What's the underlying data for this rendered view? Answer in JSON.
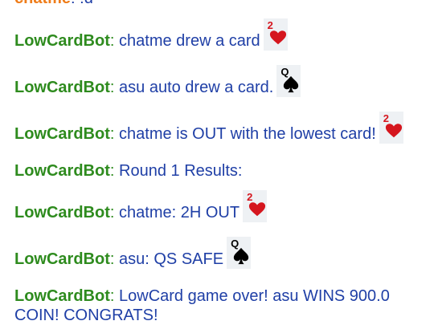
{
  "top": {
    "sender": "chatme",
    "text": ": !d"
  },
  "messages": [
    {
      "sender": "LowCardBot",
      "text": "chatme drew a card",
      "card": {
        "rank": "2",
        "suit": "hearts",
        "color": "#d5161e"
      }
    },
    {
      "sender": "LowCardBot",
      "text": "asu auto drew a card.",
      "card": {
        "rank": "Q",
        "suit": "spades",
        "color": "#000000"
      }
    },
    {
      "sender": "LowCardBot",
      "text": "chatme is OUT with the lowest card!",
      "card": {
        "rank": "2",
        "suit": "hearts",
        "color": "#d5161e"
      }
    },
    {
      "sender": "LowCardBot",
      "text": "Round 1 Results:"
    },
    {
      "sender": "LowCardBot",
      "text": "chatme: 2H OUT",
      "card": {
        "rank": "2",
        "suit": "hearts",
        "color": "#d5161e"
      }
    },
    {
      "sender": "LowCardBot",
      "text": "asu: QS SAFE",
      "card": {
        "rank": "Q",
        "suit": "spades",
        "color": "#000000"
      }
    },
    {
      "sender": "LowCardBot",
      "text": "LowCard game over! asu WINS 900.0 COIN! CONGRATS!"
    }
  ],
  "colors": {
    "bot_name": "#2e8b1e",
    "user_name": "#ef7d1a",
    "message_text": "#1f3fa6",
    "card_bg": "#eef1f4"
  }
}
